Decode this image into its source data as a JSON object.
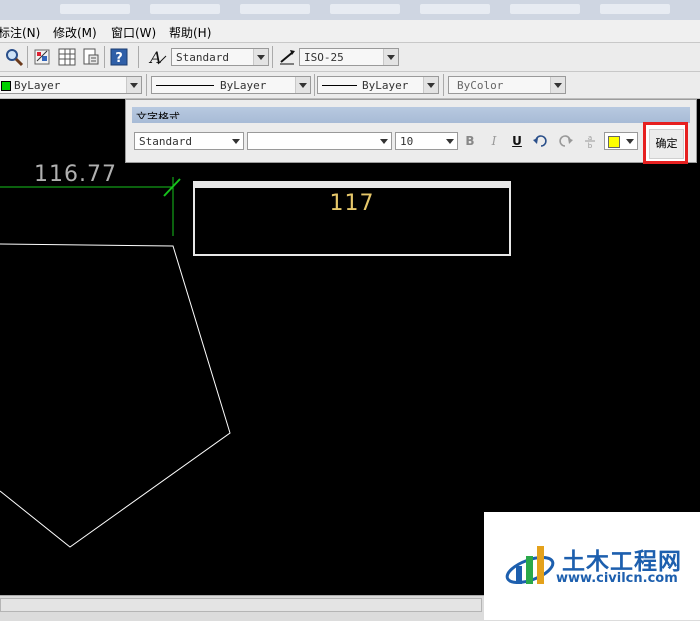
{
  "menubar": {
    "items": [
      "标注(N)",
      "修改(M)",
      "窗口(W)",
      "帮助(H)"
    ]
  },
  "toolbar": {
    "text_style": "Standard",
    "dim_style": "ISO-25"
  },
  "properties_bar": {
    "color": "ByLayer",
    "linetype": "ByLayer",
    "lineweight": "ByLayer",
    "plot_style": "ByColor"
  },
  "text_format": {
    "title": "文字格式",
    "style": "Standard",
    "font": "",
    "height": "10",
    "bold": "B",
    "italic": "I",
    "underline": "U",
    "ok_label": "确定",
    "text_color_hex": "#ffff00"
  },
  "drawing": {
    "dimension_value": "116.77",
    "edited_text": "117"
  },
  "watermark": {
    "title": "土木工程网",
    "url": "www.civilcn.com"
  }
}
